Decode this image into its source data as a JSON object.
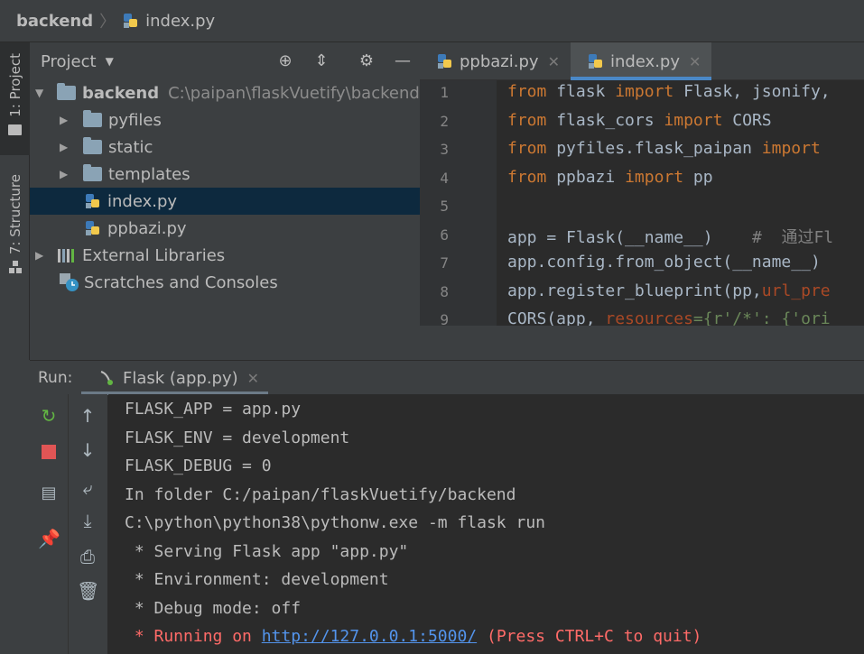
{
  "breadcrumb": {
    "root": "backend",
    "file": "index.py"
  },
  "left_strip": {
    "project_tab": "1: Project",
    "structure_tab": "7: Structure"
  },
  "project_panel": {
    "title": "Project",
    "tree": [
      {
        "label": "backend",
        "path": "C:\\paipan\\flaskVuetify\\backend",
        "type": "folder",
        "expanded": true
      },
      {
        "label": "pyfiles",
        "type": "folder"
      },
      {
        "label": "static",
        "type": "folder"
      },
      {
        "label": "templates",
        "type": "folder"
      },
      {
        "label": "index.py",
        "type": "python-file",
        "selected": true
      },
      {
        "label": "ppbazi.py",
        "type": "python-file"
      },
      {
        "label": "External Libraries",
        "type": "library"
      },
      {
        "label": "Scratches and Consoles",
        "type": "scratches"
      }
    ]
  },
  "editor": {
    "tabs": [
      {
        "label": "ppbazi.py",
        "active": false
      },
      {
        "label": "index.py",
        "active": true
      }
    ],
    "line_numbers": [
      "1",
      "2",
      "3",
      "4",
      "5",
      "6",
      "7",
      "8",
      "9"
    ],
    "lines": [
      {
        "t1": "from",
        "t2": " flask ",
        "t3": "import",
        "t4": " Flask, jsonify,"
      },
      {
        "t1": "from",
        "t2": " flask_cors ",
        "t3": "import",
        "t4": " CORS"
      },
      {
        "t1": "from",
        "t2": " pyfiles.flask_paipan ",
        "t3": "import",
        "t4": ""
      },
      {
        "t1": "from",
        "t2": " ppbazi ",
        "t3": "import",
        "t4": " pp"
      },
      {
        "t1": "",
        "t2": "",
        "t3": "",
        "t4": ""
      },
      {
        "code": "app = Flask(__name__)",
        "comment": "#  通过Fl"
      },
      {
        "code": "app.config.from_object(__name__)"
      },
      {
        "code": "app.register_blueprint(pp,",
        "param": "url_pre"
      },
      {
        "code": "CORS(app, ",
        "param": "resources",
        "rest": "={r'/*': {'ori"
      }
    ]
  },
  "run_panel": {
    "label": "Run:",
    "tab": "Flask (app.py)",
    "console": [
      "FLASK_APP = app.py",
      "FLASK_ENV = development",
      "FLASK_DEBUG = 0",
      "In folder C:/paipan/flaskVuetify/backend",
      "C:\\python\\python38\\pythonw.exe -m flask run",
      " * Serving Flask app \"app.py\"",
      " * Environment: development",
      " * Debug mode: off"
    ],
    "running_prefix": " * Running on ",
    "running_url": "http://127.0.0.1:5000/",
    "running_suffix": " (Press CTRL+C to quit)"
  },
  "colors": {
    "accent": "#4a88c7",
    "error": "#ff6b68",
    "keyword": "#cc7832",
    "link": "#5394ec"
  }
}
